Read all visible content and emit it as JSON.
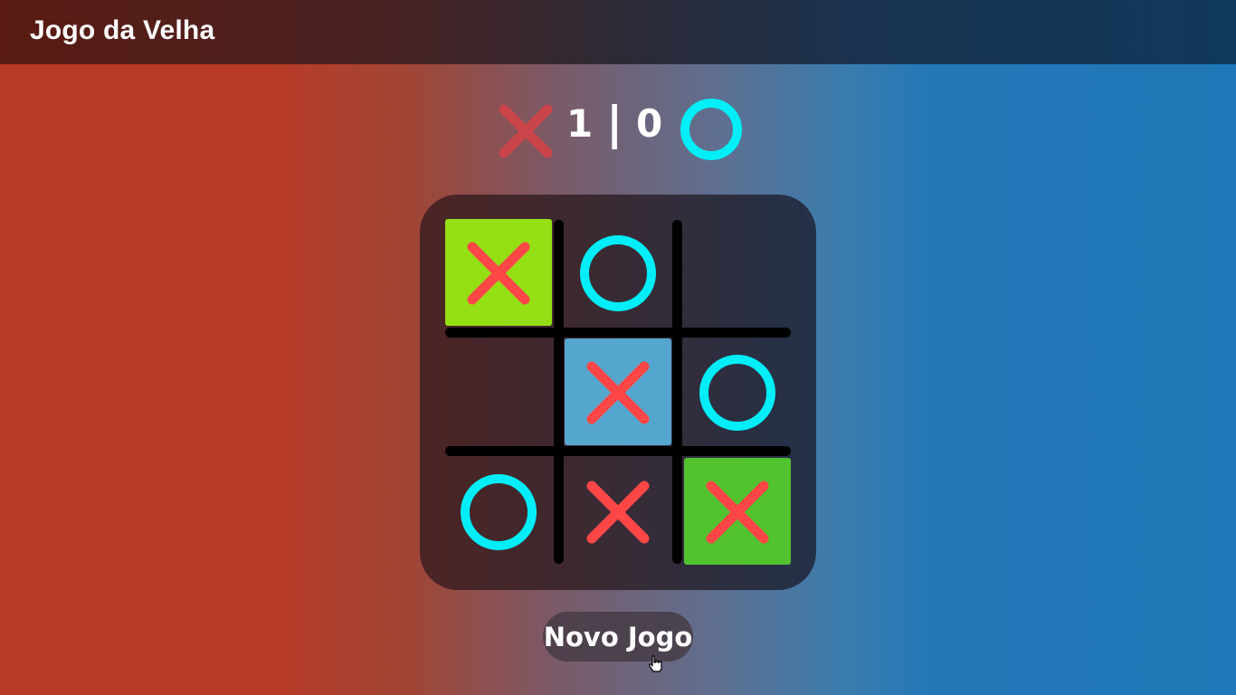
{
  "app": {
    "title": "Jogo da Velha"
  },
  "score": {
    "x": "1",
    "separator": "|",
    "o": "0",
    "x_icon": "x-mark-icon",
    "o_icon": "o-ring-icon"
  },
  "colors": {
    "x_mark": "#ff4747",
    "o_mark": "#00eef7",
    "score_x_mark": "#c9454a",
    "win_highlight_a": "#94e014",
    "win_highlight_b": "#55a6cf",
    "win_highlight_c": "#52c22f"
  },
  "board": {
    "cells": [
      {
        "row": 1,
        "col": 1,
        "mark": "X",
        "highlight": "win_highlight_a"
      },
      {
        "row": 1,
        "col": 2,
        "mark": "O",
        "highlight": ""
      },
      {
        "row": 1,
        "col": 3,
        "mark": "",
        "highlight": ""
      },
      {
        "row": 2,
        "col": 1,
        "mark": "",
        "highlight": ""
      },
      {
        "row": 2,
        "col": 2,
        "mark": "X",
        "highlight": "win_highlight_b"
      },
      {
        "row": 2,
        "col": 3,
        "mark": "O",
        "highlight": ""
      },
      {
        "row": 3,
        "col": 1,
        "mark": "O",
        "highlight": ""
      },
      {
        "row": 3,
        "col": 2,
        "mark": "X",
        "highlight": ""
      },
      {
        "row": 3,
        "col": 3,
        "mark": "X",
        "highlight": "win_highlight_c"
      }
    ]
  },
  "controls": {
    "new_game_label": "Novo Jogo"
  }
}
